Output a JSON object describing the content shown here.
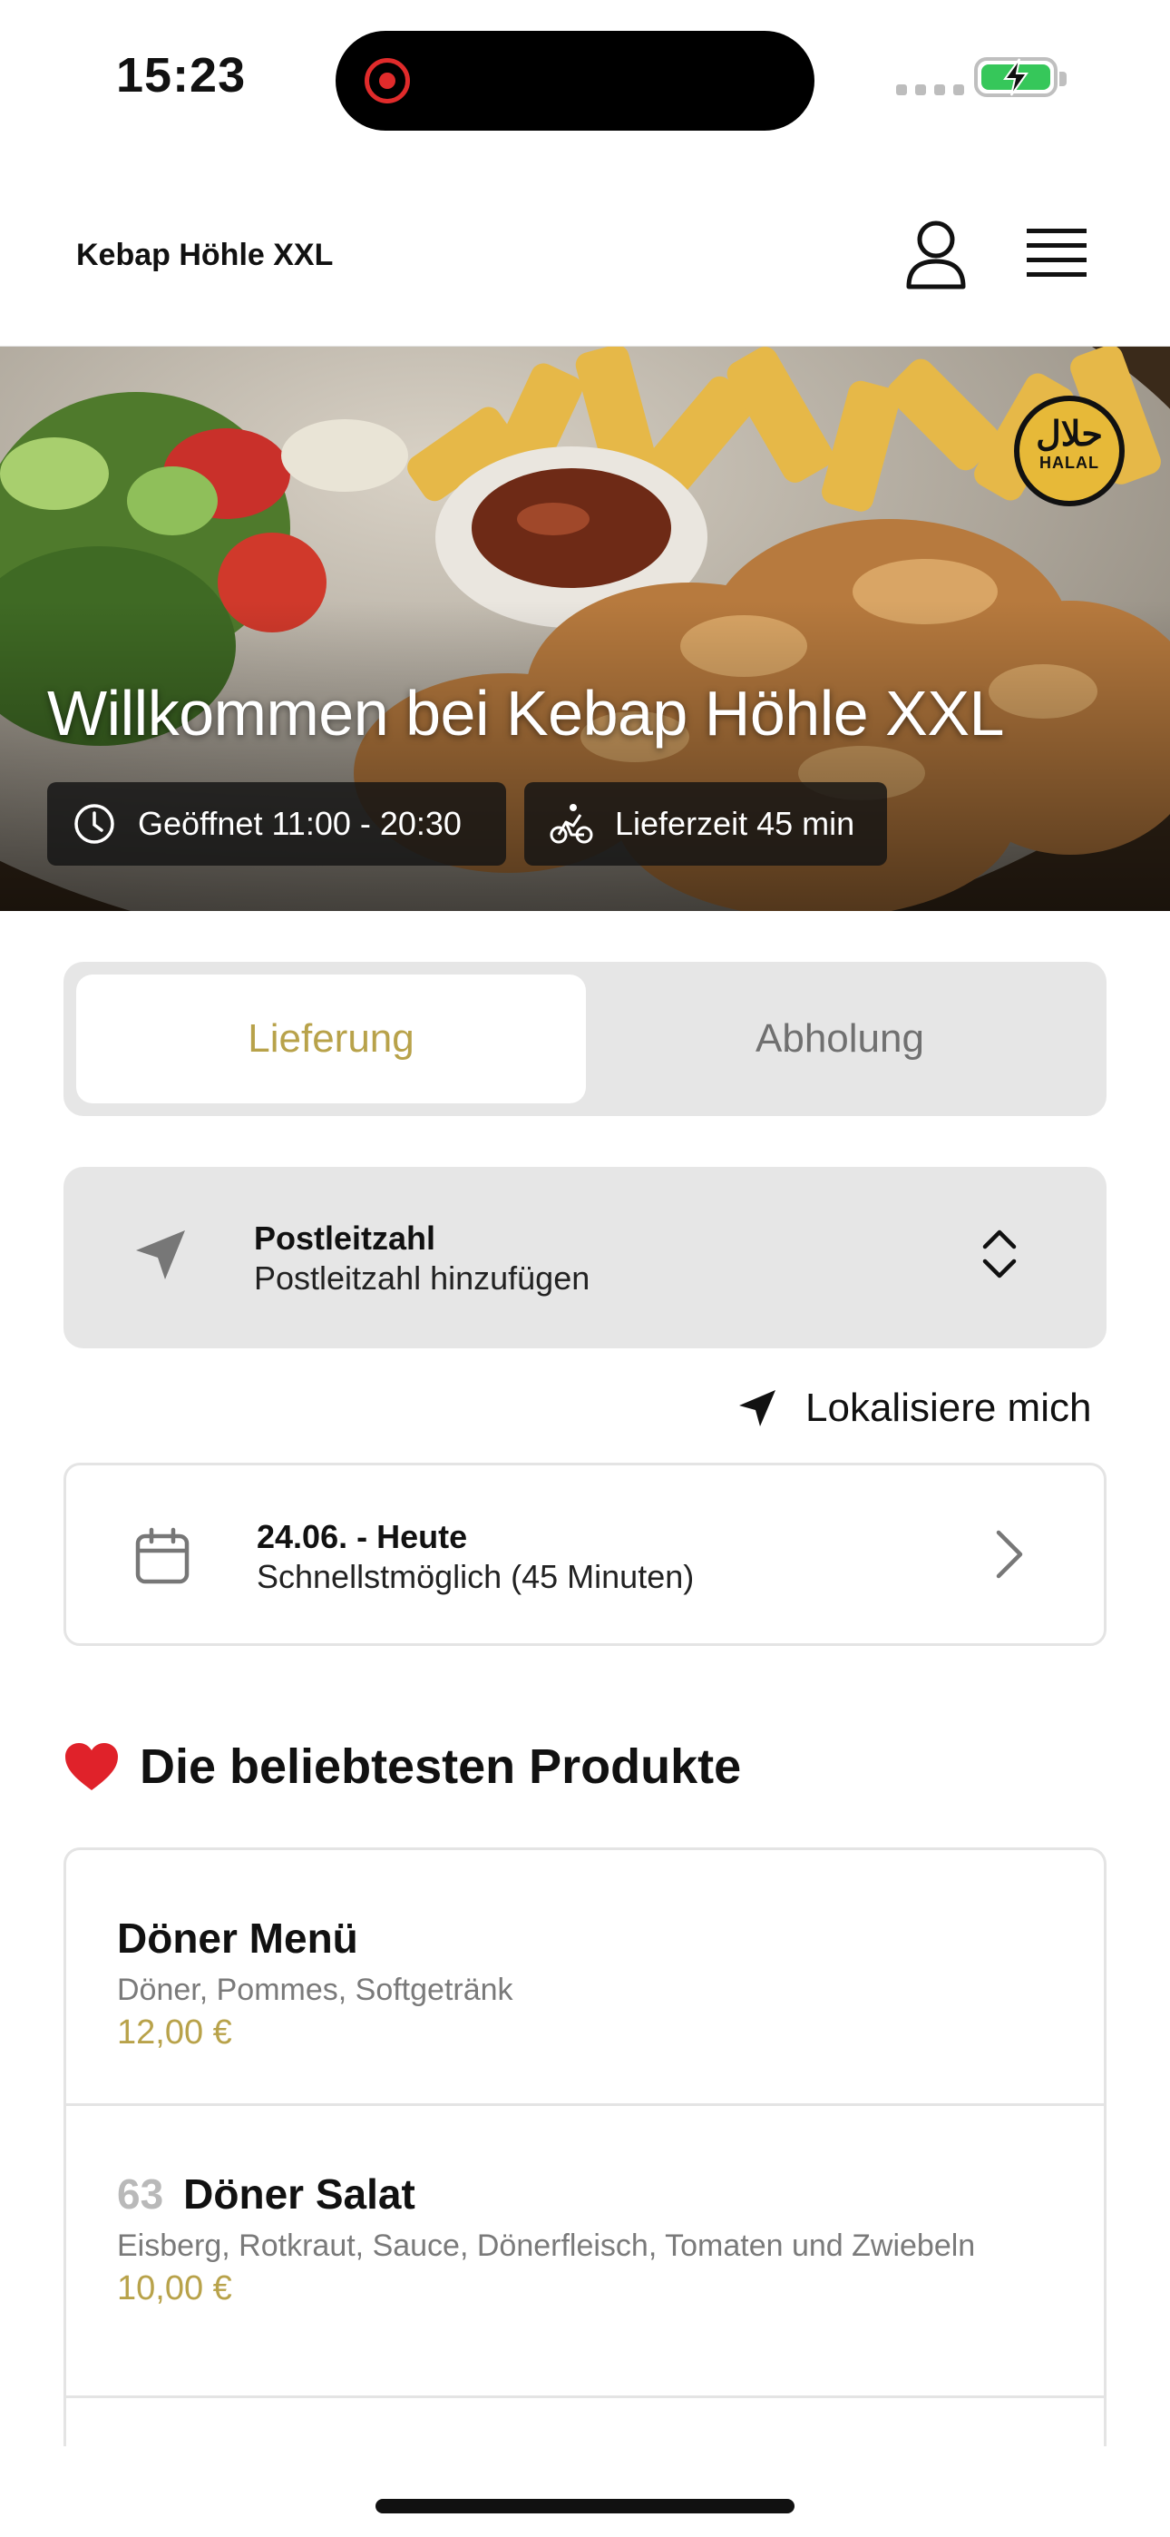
{
  "status_bar": {
    "time": "15:23"
  },
  "header": {
    "brand": "Kebap Höhle XXL"
  },
  "hero": {
    "halal_badge_arabic": "حلال",
    "halal_badge_text": "HALAL",
    "title": "Willkommen bei Kebap Höhle XXL",
    "opening_hours": "Geöffnet 11:00 - 20:30",
    "delivery_time": "Lieferzeit 45 min"
  },
  "order_mode": {
    "delivery_label": "Lieferung",
    "pickup_label": "Abholung",
    "selected": "Lieferung"
  },
  "postcode": {
    "title": "Postleitzahl",
    "placeholder": "Postleitzahl hinzufügen"
  },
  "localize": {
    "label": "Lokalisiere mich"
  },
  "schedule": {
    "date": "24.06. - Heute",
    "time": "Schnellstmöglich (45 Minuten)"
  },
  "popular": {
    "heading": "Die beliebtesten Produkte",
    "items": [
      {
        "number": "",
        "name": "Döner Menü",
        "description": "Döner, Pommes, Softgetränk",
        "price": "12,00 €"
      },
      {
        "number": "63",
        "name": "Döner Salat",
        "description": "Eisberg, Rotkraut, Sauce, Dönerfleisch, Tomaten und Zwiebeln",
        "price": "10,00 €"
      }
    ]
  },
  "colors": {
    "accent": "#b8a24a",
    "card_gray": "#e6e6e6",
    "battery_green": "#36c75a"
  }
}
